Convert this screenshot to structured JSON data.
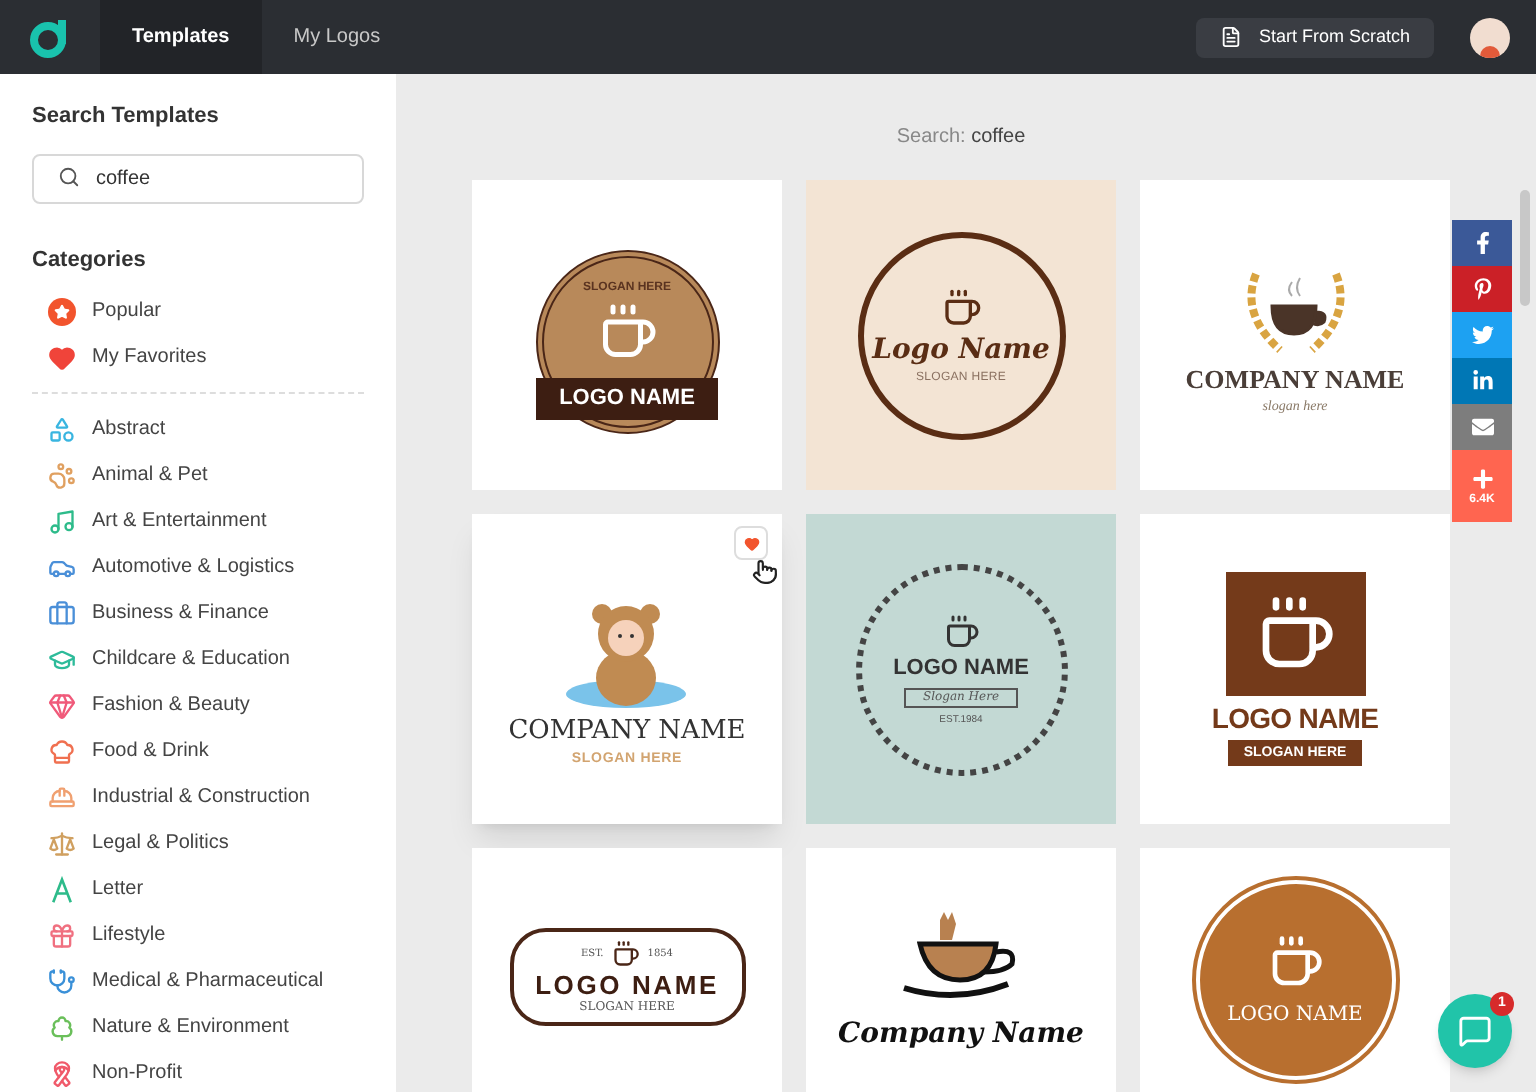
{
  "nav": {
    "tabs": [
      {
        "label": "Templates",
        "selected": true
      },
      {
        "label": "My Logos",
        "selected": false
      }
    ],
    "scratch_button": "Start From Scratch"
  },
  "sidebar": {
    "search_title": "Search Templates",
    "search_value": "coffee",
    "categories_title": "Categories",
    "top_items": [
      {
        "label": "Popular",
        "kind": "popular",
        "selected": false
      },
      {
        "label": "My Favorites",
        "kind": "favorites",
        "selected": false
      }
    ],
    "categories": [
      {
        "label": "Abstract",
        "kind": "abstract",
        "selected": false
      },
      {
        "label": "Animal & Pet",
        "kind": "animal",
        "selected": false
      },
      {
        "label": "Art & Entertainment",
        "kind": "art",
        "selected": false
      },
      {
        "label": "Automotive & Logistics",
        "kind": "auto",
        "selected": false
      },
      {
        "label": "Business & Finance",
        "kind": "business",
        "selected": false
      },
      {
        "label": "Childcare & Education",
        "kind": "education",
        "selected": false
      },
      {
        "label": "Fashion & Beauty",
        "kind": "fashion",
        "selected": false
      },
      {
        "label": "Food & Drink",
        "kind": "food",
        "selected": false
      },
      {
        "label": "Industrial & Construction",
        "kind": "industrial",
        "selected": false
      },
      {
        "label": "Legal & Politics",
        "kind": "legal",
        "selected": false
      },
      {
        "label": "Letter",
        "kind": "letter",
        "selected": false
      },
      {
        "label": "Lifestyle",
        "kind": "lifestyle",
        "selected": false
      },
      {
        "label": "Medical & Pharmaceutical",
        "kind": "medical",
        "selected": false
      },
      {
        "label": "Nature & Environment",
        "kind": "nature",
        "selected": false
      },
      {
        "label": "Non-Profit",
        "kind": "nonprofit",
        "selected": false
      }
    ]
  },
  "results": {
    "search_label": "Search:",
    "query": "coffee",
    "templates": [
      {
        "kind": "badge",
        "name": "LOGO NAME",
        "slogan": "SLOGAN HERE",
        "favorite": false
      },
      {
        "kind": "ring",
        "name": "Logo Name",
        "slogan": "SLOGAN HERE",
        "favorite": false
      },
      {
        "kind": "laurel",
        "name": "COMPANY NAME",
        "slogan": "slogan here",
        "favorite": false
      },
      {
        "kind": "mascot",
        "name": "COMPANY NAME",
        "slogan": "SLOGAN HERE",
        "favorite": true
      },
      {
        "kind": "stamp",
        "name": "LOGO NAME",
        "slogan": "Slogan Here",
        "extra": "EST.1984",
        "favorite": false
      },
      {
        "kind": "square",
        "name": "LOGO NAME",
        "slogan": "SLOGAN HERE",
        "favorite": false
      },
      {
        "kind": "hexagon",
        "name": "LOGO NAME",
        "slogan": "SLOGAN HERE",
        "extra": "EST.",
        "extra2": "1854",
        "favorite": false
      },
      {
        "kind": "cup",
        "name": "Company Name",
        "favorite": false
      },
      {
        "kind": "circle",
        "name": "LOGO NAME",
        "favorite": false
      }
    ]
  },
  "share": {
    "buttons": [
      {
        "kind": "facebook"
      },
      {
        "kind": "pinterest"
      },
      {
        "kind": "twitter"
      },
      {
        "kind": "linkedin"
      },
      {
        "kind": "email"
      },
      {
        "kind": "more",
        "count": "6.4K"
      }
    ]
  },
  "chat": {
    "badge": "1"
  }
}
